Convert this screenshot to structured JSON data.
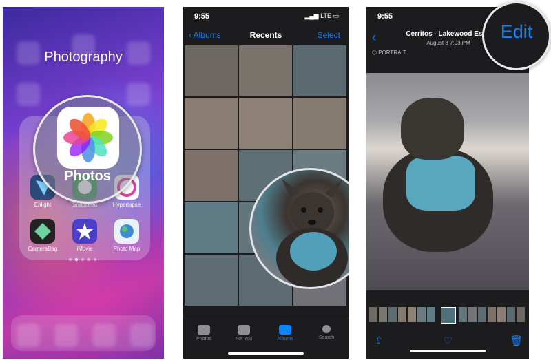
{
  "panel1": {
    "folder_title": "Photography",
    "magnified_app": {
      "label": "Photos",
      "icon": "photos-flower-icon"
    },
    "apps": [
      {
        "label": "Enlight",
        "icon": "enlight-icon",
        "color": "#3a5a8c"
      },
      {
        "label": "Snapseed",
        "icon": "snapseed-icon",
        "color": "#48a860"
      },
      {
        "label": "Hyperlapse",
        "icon": "hyperlapse-icon",
        "color": "#f0f0f0"
      },
      {
        "label": "CameraBag",
        "icon": "camerabag-icon",
        "color": "#2a2a2a"
      },
      {
        "label": "iMovie",
        "icon": "imovie-icon",
        "color": "#5b4bd6"
      },
      {
        "label": "Photo Map",
        "icon": "photo-map-icon",
        "color": "#4a90d8"
      }
    ],
    "page_dots": 5,
    "active_dot": 1
  },
  "panel2": {
    "status_time": "9:55",
    "status_signal": "LTE",
    "back_label": "Albums",
    "title": "Recents",
    "select_label": "Select",
    "tabs": [
      {
        "label": "Photos",
        "icon": "photos-tab-icon",
        "active": false
      },
      {
        "label": "For You",
        "icon": "for-you-icon",
        "active": false
      },
      {
        "label": "Albums",
        "icon": "albums-icon",
        "active": true
      },
      {
        "label": "Search",
        "icon": "search-icon",
        "active": false
      }
    ]
  },
  "panel3": {
    "status_time": "9:55",
    "title": "Cerritos - Lakewood Estat",
    "date": "August 8  7:03 PM",
    "portrait_badge": "PORTRAIT",
    "edit_label": "Edit",
    "toolbar": [
      {
        "icon": "share-icon"
      },
      {
        "icon": "heart-icon"
      },
      {
        "icon": "trash-icon"
      }
    ]
  },
  "colors": {
    "accent": "#0a84ff",
    "dark_bg": "#1c1c1e"
  }
}
